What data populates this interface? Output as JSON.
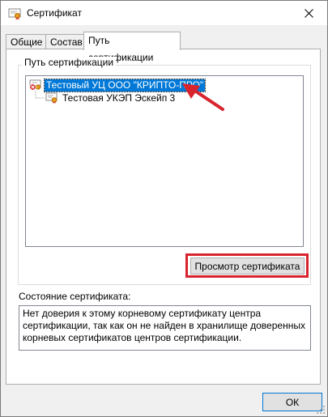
{
  "window": {
    "title": "Сертификат",
    "icon": "certificate-icon",
    "close_icon": "close-icon"
  },
  "tabs": [
    {
      "label": "Общие",
      "active": false
    },
    {
      "label": "Состав",
      "active": false
    },
    {
      "label": "Путь сертификации",
      "active": true
    }
  ],
  "cert_path": {
    "group_label": "Путь сертификации",
    "tree": [
      {
        "label": "Тестовый УЦ ООО \"КРИПТО-ПРО\"",
        "level": 0,
        "selected": true,
        "status_icon": "cert-error-icon"
      },
      {
        "label": "Тестовая УКЭП Эскейп 3",
        "level": 1,
        "selected": false,
        "status_icon": "certificate-icon"
      }
    ],
    "view_button_label": "Просмотр сертификата"
  },
  "status": {
    "label": "Состояние сертификата:",
    "text": "Нет доверия к этому корневому сертификату центра сертификации, так как он не найден в хранилище доверенных корневых сертификатов центров сертификации."
  },
  "footer": {
    "ok_label": "ОК"
  },
  "colors": {
    "selection": "#0078d7",
    "annotation_red": "#d9232d",
    "button_face": "#e1e1e1"
  }
}
